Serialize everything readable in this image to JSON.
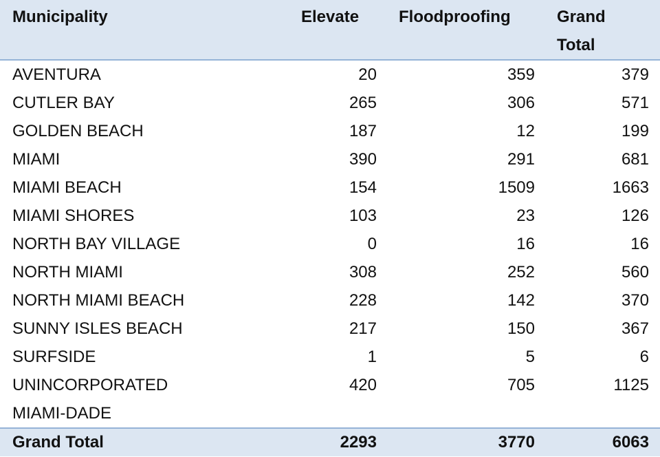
{
  "table": {
    "headers": {
      "municipality": "Municipality",
      "elevate": "Elevate",
      "floodproofing": "Floodproofing",
      "grand_total_line1": "Grand",
      "grand_total_line2": "Total"
    },
    "rows": [
      {
        "municipality": "AVENTURA",
        "elevate": "20",
        "floodproofing": "359",
        "total": "379"
      },
      {
        "municipality": "CUTLER BAY",
        "elevate": "265",
        "floodproofing": "306",
        "total": "571"
      },
      {
        "municipality": "GOLDEN BEACH",
        "elevate": "187",
        "floodproofing": "12",
        "total": "199"
      },
      {
        "municipality": "MIAMI",
        "elevate": "390",
        "floodproofing": "291",
        "total": "681"
      },
      {
        "municipality": "MIAMI BEACH",
        "elevate": "154",
        "floodproofing": "1509",
        "total": "1663"
      },
      {
        "municipality": "MIAMI SHORES",
        "elevate": "103",
        "floodproofing": "23",
        "total": "126"
      },
      {
        "municipality": "NORTH BAY VILLAGE",
        "elevate": "0",
        "floodproofing": "16",
        "total": "16"
      },
      {
        "municipality": "NORTH MIAMI",
        "elevate": "308",
        "floodproofing": "252",
        "total": "560"
      },
      {
        "municipality": "NORTH MIAMI BEACH",
        "elevate": "228",
        "floodproofing": "142",
        "total": "370"
      },
      {
        "municipality": "SUNNY ISLES BEACH",
        "elevate": "217",
        "floodproofing": "150",
        "total": "367"
      },
      {
        "municipality": "SURFSIDE",
        "elevate": "1",
        "floodproofing": "5",
        "total": "6"
      },
      {
        "municipality": "UNINCORPORATED",
        "elevate": "420",
        "floodproofing": "705",
        "total": "1125"
      },
      {
        "municipality": "MIAMI-DADE",
        "elevate": "",
        "floodproofing": "",
        "total": ""
      }
    ],
    "footer": {
      "label": "Grand Total",
      "elevate": "2293",
      "floodproofing": "3770",
      "total": "6063"
    }
  },
  "colors": {
    "header_bg": "#dce6f2",
    "border": "#95b3d7"
  }
}
